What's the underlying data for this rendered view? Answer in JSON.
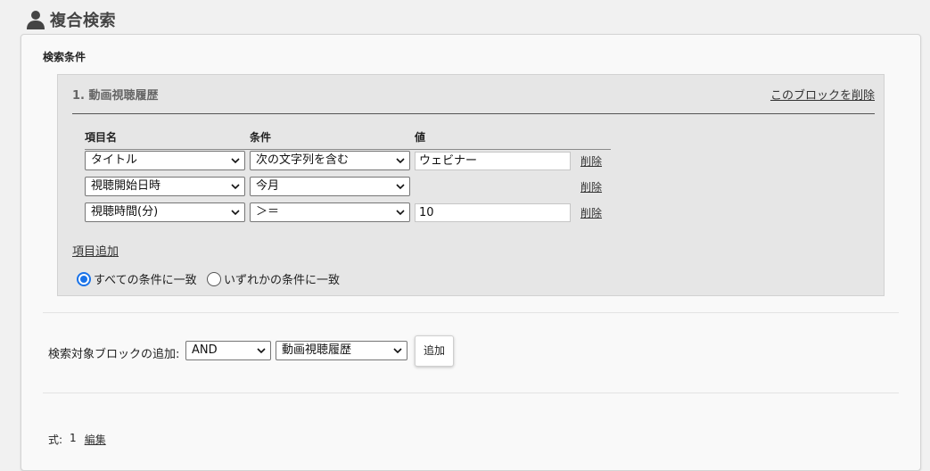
{
  "header": {
    "title": "複合検索",
    "icon": "person-icon"
  },
  "section": {
    "label": "検索条件"
  },
  "block": {
    "title": "1. 動画視聴履歴",
    "delete_label": "このブロックを削除",
    "columns": {
      "item": "項目名",
      "condition": "条件",
      "value": "値"
    },
    "rows": [
      {
        "item": "タイトル",
        "condition": "次の文字列を含む",
        "value": "ウェビナー",
        "delete": "削除"
      },
      {
        "item": "視聴開始日時",
        "condition": "今月",
        "value": "",
        "delete": "削除"
      },
      {
        "item": "視聴時間(分)",
        "condition": "＞＝",
        "value": "10",
        "delete": "削除"
      }
    ],
    "add_item_label": "項目追加",
    "match_options": [
      {
        "label": "すべての条件に一致",
        "selected": true
      },
      {
        "label": "いずれかの条件に一致",
        "selected": false
      }
    ]
  },
  "add_block": {
    "label": "検索対象ブロックの追加:",
    "operator": "AND",
    "target": "動画視聴履歴",
    "button_label": "追加"
  },
  "formula": {
    "label": "式:",
    "value": "1",
    "edit_label": "編集"
  },
  "colors": {
    "radio_accent": "#1a73e8",
    "block_bg": "#e6e6e6",
    "page_bg": "#f1f1f1"
  }
}
